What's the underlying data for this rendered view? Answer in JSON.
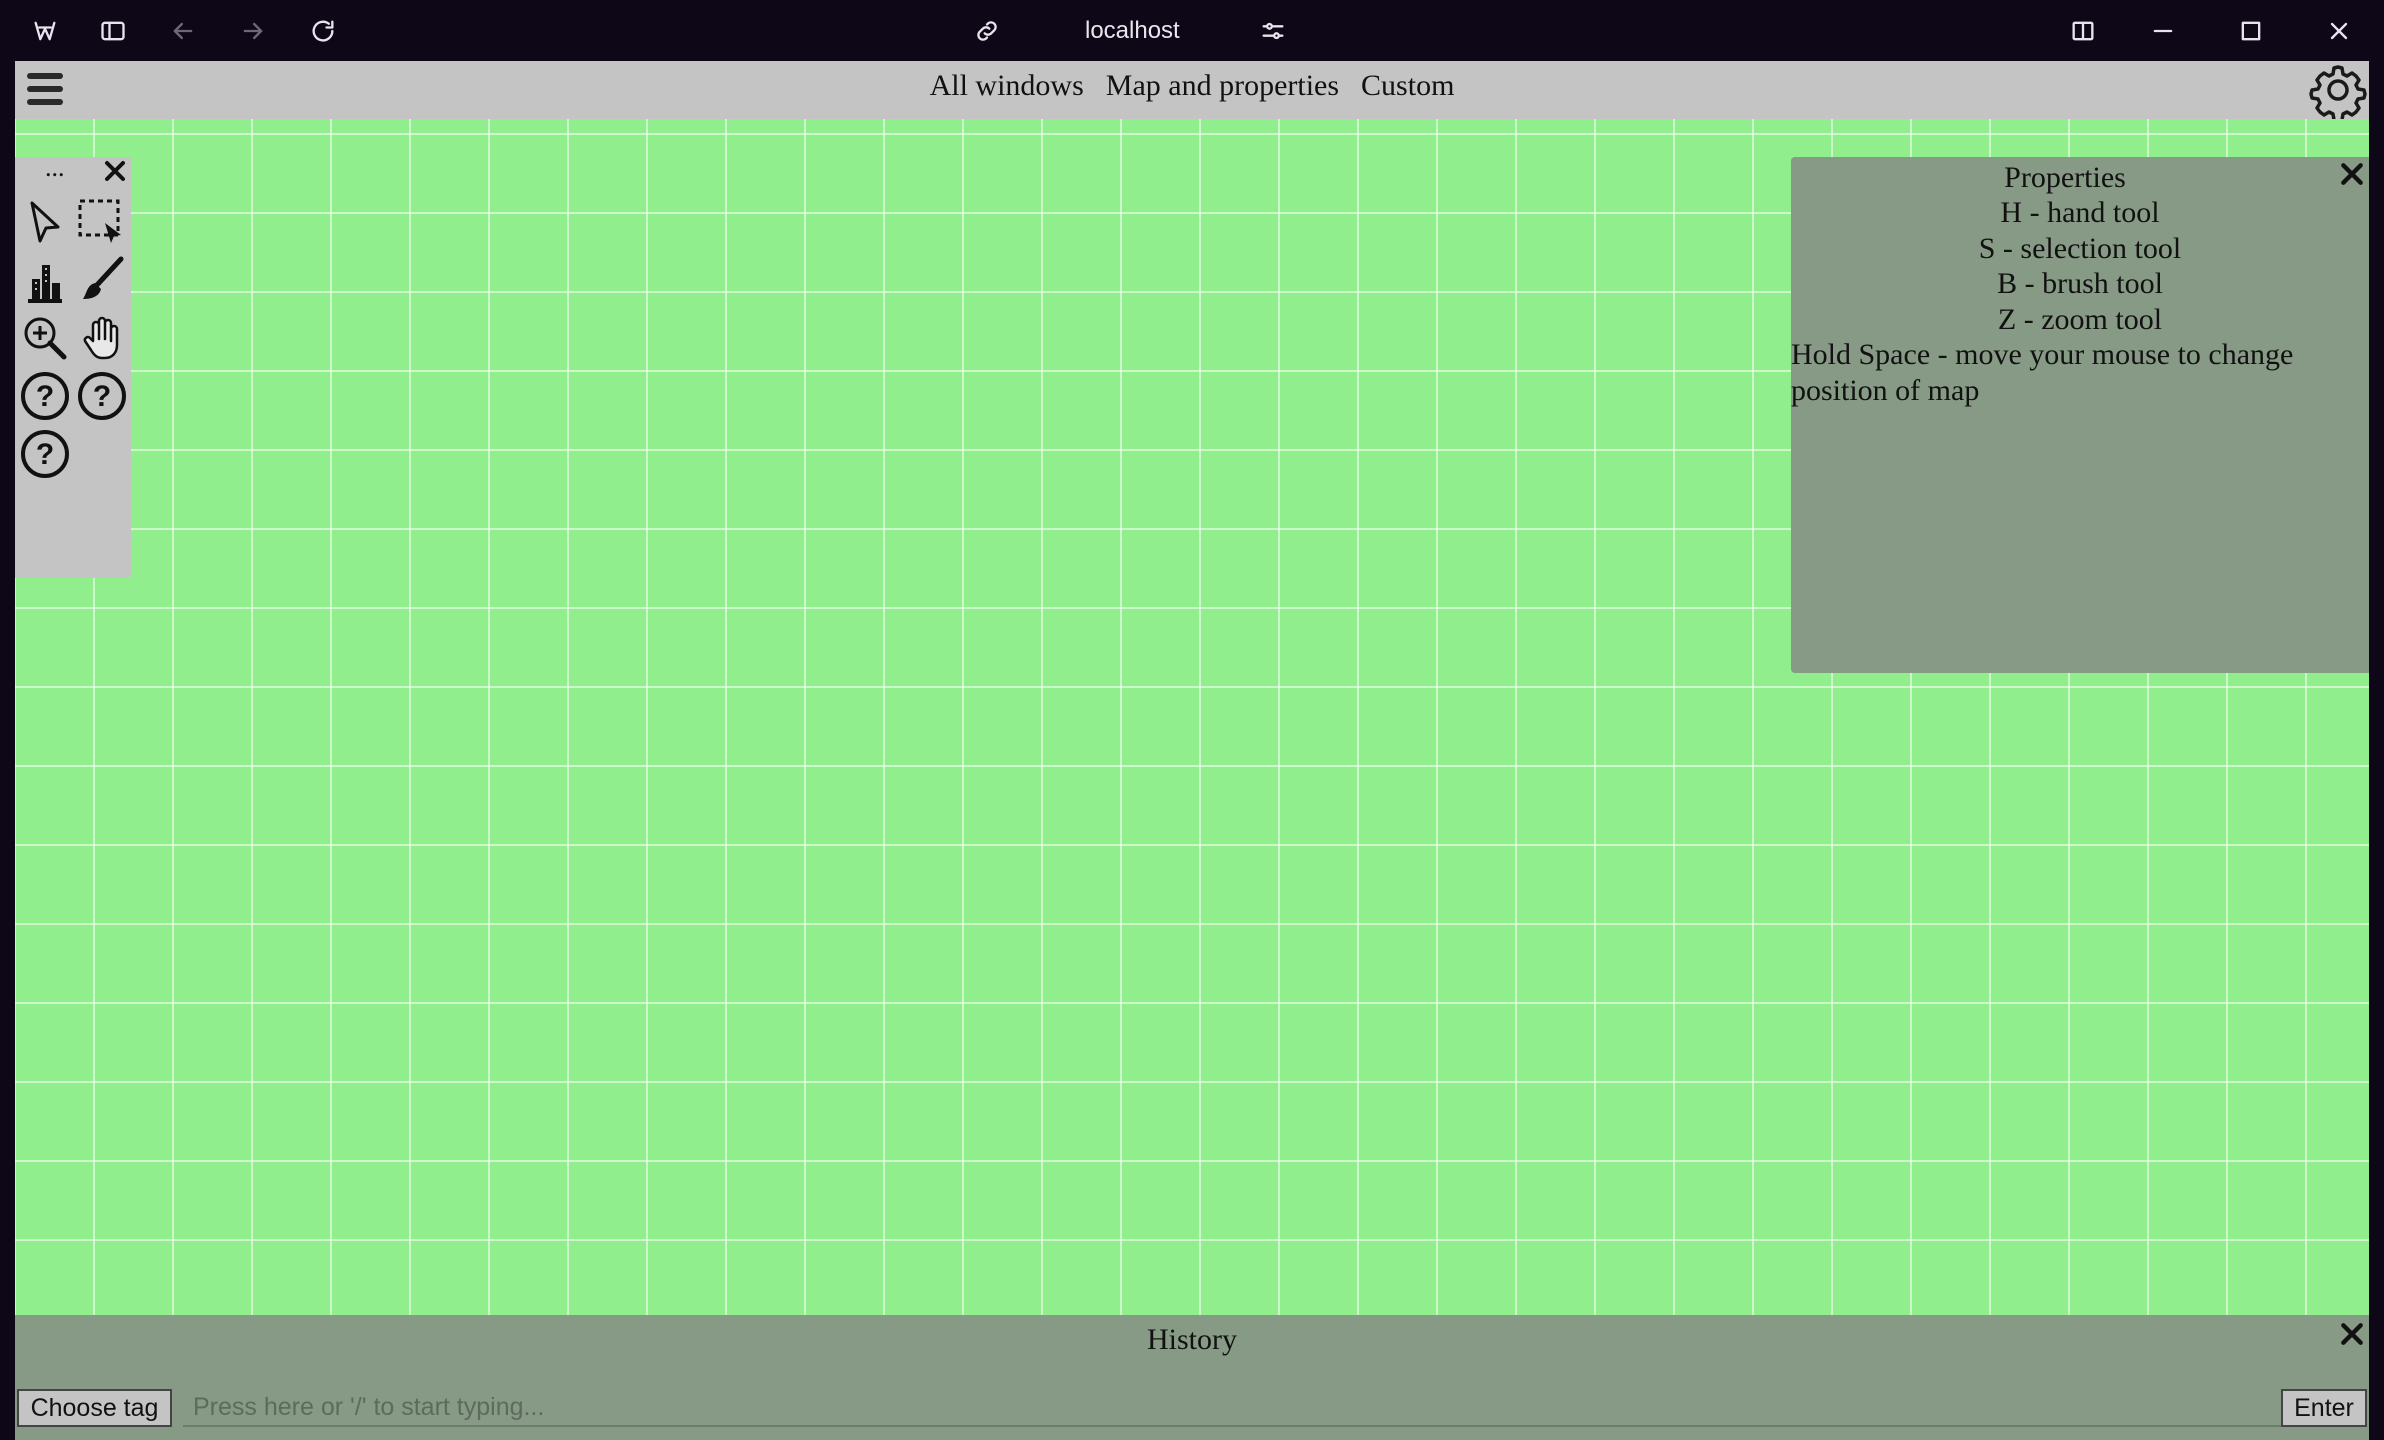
{
  "browser": {
    "address": "localhost",
    "icons": [
      "app-logo-icon",
      "sidebar-toggle-icon",
      "back-icon",
      "forward-icon",
      "reload-icon",
      "link-icon",
      "site-settings-icon",
      "split-view-icon",
      "minimize-icon",
      "maximize-icon",
      "close-icon"
    ]
  },
  "menubar": {
    "items": [
      "All windows",
      "Map and properties",
      "Custom"
    ]
  },
  "toolbox": {
    "handle": "...",
    "tools": [
      "pointer-tool",
      "selection-tool",
      "building-tool",
      "brush-tool",
      "zoom-tool",
      "hand-tool",
      "help-tool-1",
      "help-tool-2",
      "help-tool-3"
    ]
  },
  "properties": {
    "title": "Properties",
    "lines": [
      "H - hand tool",
      "S - selection tool",
      "B - brush tool",
      "Z - zoom tool"
    ],
    "note": "Hold Space - move your mouse to change position of map"
  },
  "history": {
    "title": "History"
  },
  "command": {
    "choose_tag": "Choose tag",
    "placeholder": "Press here or '/' to start typing...",
    "enter": "Enter"
  },
  "colors": {
    "map": "#90ee8c",
    "panel": "#879a86",
    "bar": "#c4c4c4",
    "chrome": "#0e0718"
  }
}
